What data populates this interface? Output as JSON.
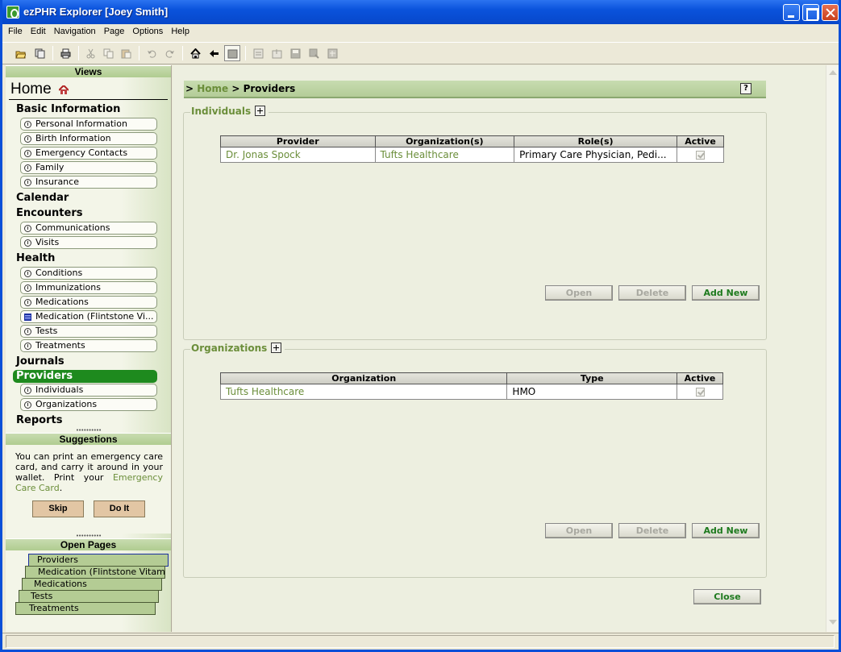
{
  "window": {
    "title": "ezPHR Explorer [Joey Smith]"
  },
  "menu": [
    "File",
    "Edit",
    "Navigation",
    "Page",
    "Options",
    "Help"
  ],
  "toolbar": {
    "icons": [
      "open-folder-icon",
      "copy-pages-icon",
      "print-icon",
      "cut-icon",
      "copy-icon",
      "paste-icon",
      "undo-icon",
      "redo-icon",
      "home-icon",
      "back-icon",
      "page-icon",
      "import-icon",
      "export-icon",
      "save-icon",
      "save-as-icon",
      "send-icon"
    ]
  },
  "sidebar": {
    "views_header": "Views",
    "home_label": "Home",
    "sections": {
      "basic": "Basic Information",
      "calendar": "Calendar",
      "encounters": "Encounters",
      "health": "Health",
      "journals": "Journals",
      "providers": "Providers",
      "reports": "Reports"
    },
    "basic_items": [
      "Personal Information",
      "Birth Information",
      "Emergency Contacts",
      "Family",
      "Insurance"
    ],
    "encounter_items": [
      "Communications",
      "Visits"
    ],
    "health_items": [
      "Conditions",
      "Immunizations",
      "Medications",
      "Medication (Flintstone Vi...",
      "Tests",
      "Treatments"
    ],
    "provider_items": [
      "Individuals",
      "Organizations"
    ],
    "suggestions_header": "Suggestions",
    "suggestion_text": "You can print an emergency care card, and carry it around in your wallet. Print your",
    "suggestion_link": "Emergency Care Card",
    "suggestion_end": ".",
    "skip_label": "Skip",
    "doit_label": "Do It",
    "open_pages_header": "Open Pages",
    "open_pages": [
      "Providers",
      "Medication (Flintstone Vitamins)",
      "Medications",
      "Tests",
      "Treatments"
    ]
  },
  "breadcrumb": {
    "prefix": "> ",
    "home": "Home",
    "separator": " > ",
    "current": "Providers",
    "help": "?"
  },
  "individuals": {
    "title": "Individuals",
    "columns": [
      "Provider",
      "Organization(s)",
      "Role(s)",
      "Active"
    ],
    "rows": [
      {
        "provider": "Dr. Jonas Spock",
        "organization": "Tufts Healthcare",
        "role": "Primary Care Physician, Pedi...",
        "active": true
      }
    ],
    "buttons": {
      "open": "Open",
      "delete": "Delete",
      "add": "Add New"
    }
  },
  "organizations": {
    "title": "Organizations",
    "columns": [
      "Organization",
      "Type",
      "Active"
    ],
    "rows": [
      {
        "organization": "Tufts Healthcare",
        "type": "HMO",
        "active": true
      }
    ],
    "buttons": {
      "open": "Open",
      "delete": "Delete",
      "add": "Add New"
    }
  },
  "close_label": "Close",
  "colors": {
    "accent_green": "#6b8e3a",
    "active_nav": "#1e8a1e",
    "title_blue": "#0a53dc"
  }
}
